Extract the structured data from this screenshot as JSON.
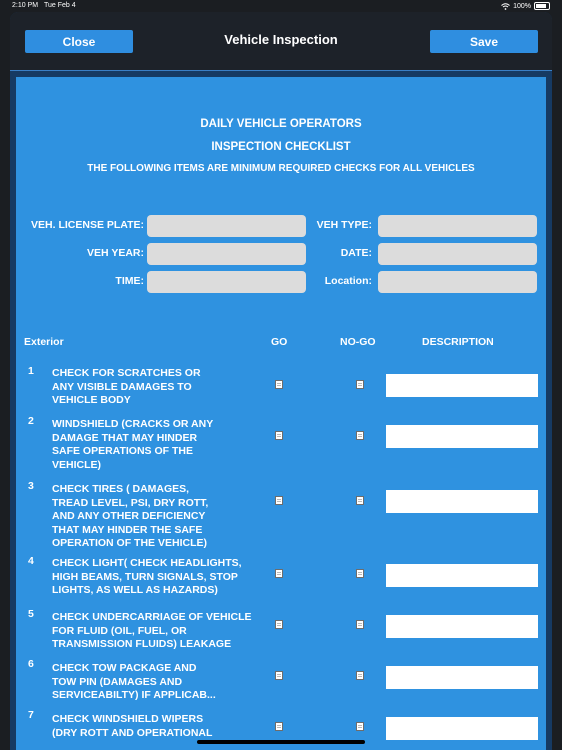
{
  "status": {
    "time": "2:10 PM",
    "date": "Tue Feb 4",
    "battery": "100%"
  },
  "nav": {
    "close_label": "Close",
    "title": "Vehicle  Inspection",
    "save_label": "Save"
  },
  "form": {
    "title1": "DAILY VEHICLE OPERATORS",
    "title2": "INSPECTION CHECKLIST",
    "subtitle": "THE FOLLOWING ITEMS ARE MINIMUM REQUIRED CHECKS FOR ALL VEHICLES",
    "fields": {
      "license_plate": "VEH. LICENSE PLATE:",
      "veh_type": "VEH TYPE:",
      "veh_year": "VEH  YEAR:",
      "date": "DATE:",
      "time": "TIME:",
      "location": "Location:"
    },
    "columns": {
      "section": "Exterior",
      "go": "GO",
      "nogo": "NO-GO",
      "description": "DESCRIPTION"
    },
    "items": [
      {
        "num": "1",
        "text": "CHECK FOR SCRATCHES OR\nANY VISIBLE DAMAGES TO\nVEHICLE BODY"
      },
      {
        "num": "2",
        "text": "WINDSHIELD (CRACKS OR ANY\nDAMAGE THAT MAY HINDER\nSAFE OPERATIONS OF THE\nVEHICLE)"
      },
      {
        "num": "3",
        "text": "CHECK TIRES ( DAMAGES,\nTREAD LEVEL, PSI, DRY ROTT,\nAND ANY OTHER DEFICIENCY\nTHAT MAY HINDER THE SAFE\nOPERATION OF THE VEHICLE)"
      },
      {
        "num": "4",
        "text": "CHECK LIGHT( CHECK HEADLIGHTS,\nHIGH BEAMS, TURN SIGNALS, STOP\nLIGHTS, AS WELL AS HAZARDS)"
      },
      {
        "num": "5",
        "text": "CHECK UNDERCARRIAGE OF VEHICLE\nFOR FLUID (OIL, FUEL, OR\nTRANSMISSION FLUIDS) LEAKAGE"
      },
      {
        "num": "6",
        "text": "CHECK TOW PACKAGE AND\nTOW PIN (DAMAGES AND\nSERVICEABILTY) IF APPLICAB..."
      },
      {
        "num": "7",
        "text": "CHECK WINDSHIELD WIPERS\n(DRY ROTT AND OPERATIONAL"
      }
    ]
  }
}
